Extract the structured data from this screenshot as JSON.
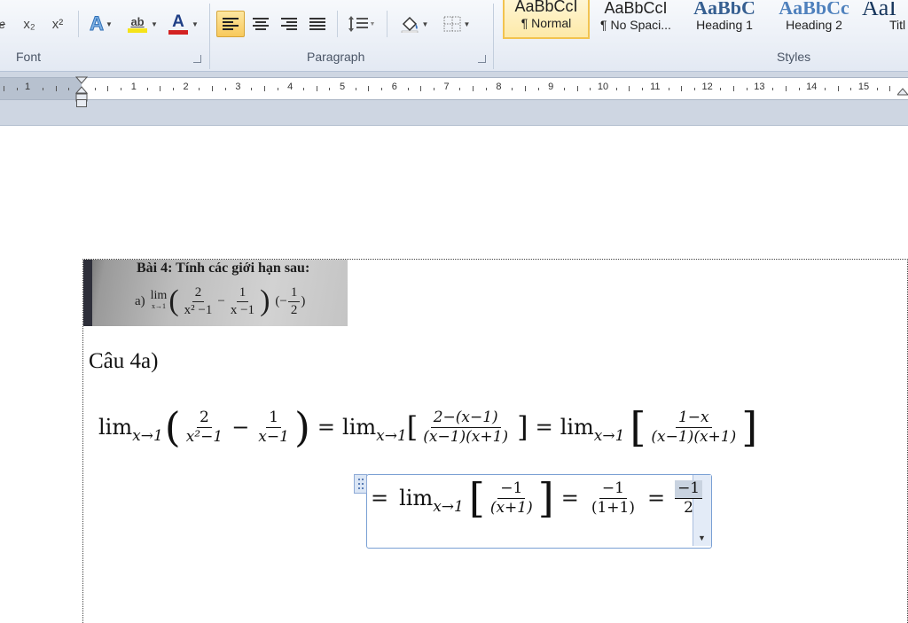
{
  "ribbon": {
    "font_group": {
      "label": "Font",
      "buttons": [
        {
          "name": "strikethrough",
          "glyph": "ab"
        },
        {
          "name": "subscript",
          "glyph": "x₂"
        },
        {
          "name": "superscript",
          "glyph": "x²"
        },
        {
          "name": "text-effects",
          "glyph": "A"
        },
        {
          "name": "highlight",
          "glyph": "ab"
        },
        {
          "name": "font-color",
          "glyph": "A"
        }
      ]
    },
    "paragraph_group": {
      "label": "Paragraph"
    },
    "styles_group": {
      "label": "Styles",
      "styles": [
        {
          "preview": "AaBbCcI",
          "name": "¶ Normal",
          "selected": true
        },
        {
          "preview": "AaBbCcI",
          "name": "¶ No Spaci...",
          "selected": false
        },
        {
          "preview": "AaBbC",
          "name": "Heading 1",
          "selected": false
        },
        {
          "preview": "AaBbCc",
          "name": "Heading 2",
          "selected": false
        },
        {
          "preview": "AaI",
          "name": "Titl",
          "selected": false
        }
      ]
    },
    "colors": {
      "highlight": "#f5e31a",
      "font_color": "#d32222",
      "selected_style": "#f5c542"
    }
  },
  "ruler": {
    "left_numbers": [
      "1"
    ],
    "numbers": [
      "1",
      "2",
      "3",
      "4",
      "5",
      "6",
      "7",
      "8",
      "9",
      "10",
      "11",
      "12",
      "13",
      "14",
      "15"
    ]
  },
  "document": {
    "photo_text": {
      "line1": "Bài 4: Tính các giới hạn sau:",
      "line2_prefix": "a)",
      "lim": "lim",
      "lim_sub": "x→1",
      "f1_num": "2",
      "f1_den": "x² −1",
      "minus": "−",
      "f2_num": "1",
      "f2_den": "x −1",
      "answer_prefix": "(−",
      "ans_num": "1",
      "ans_den": "2",
      "answer_suffix": ")"
    },
    "heading": "Câu 4a)",
    "eq1": {
      "lim": "lim",
      "sub": "x→1",
      "f1_num": "2",
      "f1_den": "x²−1",
      "minus": "−",
      "f2_num": "1",
      "f2_den": "x−1",
      "eq": "=",
      "f3_num": "2−(x−1)",
      "f3_den": "(x−1)(x+1)",
      "f4_num": "1−x",
      "f4_den": "(x−1)(x+1)"
    },
    "eq2": {
      "eq": "=",
      "lim": "lim",
      "sub": "x→1",
      "f1_num": "−1",
      "f1_den": "(x+1)",
      "f2_num": "−1",
      "f2_den": "(1+1)",
      "f3_num": "−1",
      "f3_den": "2"
    }
  }
}
